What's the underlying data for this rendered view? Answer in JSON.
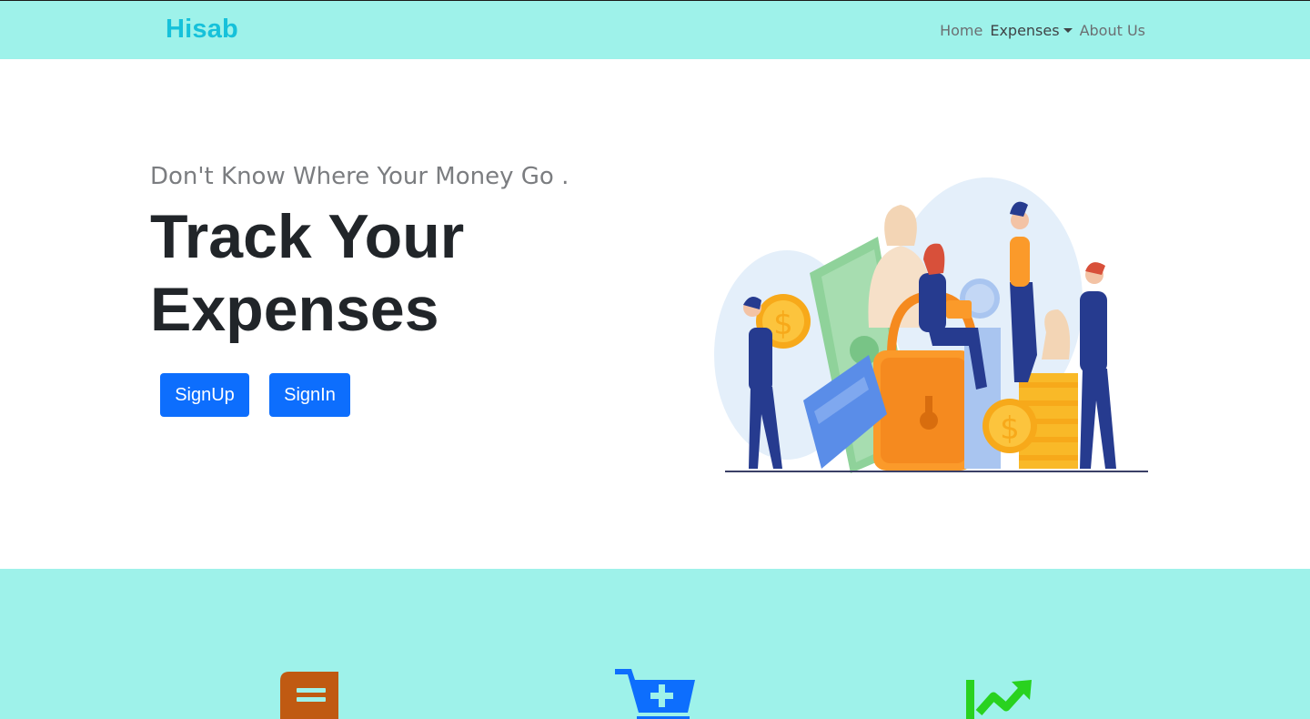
{
  "navbar": {
    "brand": "Hisab",
    "links": [
      {
        "label": "Home"
      },
      {
        "label": "Expenses",
        "has_dropdown": true
      },
      {
        "label": "About Us"
      }
    ],
    "bg_color": "#9ef2ea",
    "brand_color": "#16c1da"
  },
  "hero": {
    "subtitle": "Don't Know Where Your Money Go .",
    "title_line1": "Track Your",
    "title_line2": "Expenses",
    "buttons": {
      "signup": "SignUp",
      "signin": "SignIn"
    },
    "button_color": "#0d6efd",
    "illustration": "people-with-money-coins-card-illustration"
  },
  "features": {
    "bg_color": "#9ef2ea",
    "icons": [
      {
        "name": "book-icon",
        "color": "#c05a12"
      },
      {
        "name": "cart-plus-icon",
        "color": "#0d6efd"
      },
      {
        "name": "trend-up-icon",
        "color": "#29d21f"
      }
    ]
  }
}
